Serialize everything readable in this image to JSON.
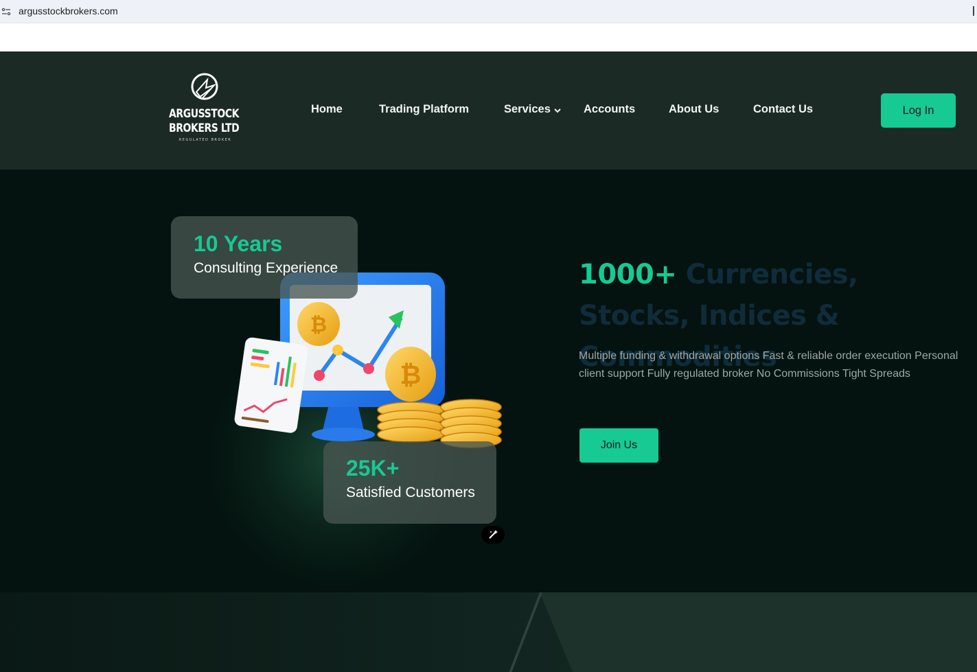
{
  "browser": {
    "url": "argusstockbrokers.com"
  },
  "logo": {
    "line1": "ARGUSSTOCK",
    "line2": "BROKERS LTD",
    "tagline": "REGULATED BROKER"
  },
  "nav": {
    "items": [
      {
        "label": "Home"
      },
      {
        "label": "Trading Platform"
      },
      {
        "label": "Services",
        "has_dropdown": true
      },
      {
        "label": "Accounts"
      },
      {
        "label": "About Us"
      },
      {
        "label": "Contact Us"
      }
    ],
    "login_label": "Log In"
  },
  "hero": {
    "stats": [
      {
        "value": "10 Years",
        "label": "Consulting Experience"
      },
      {
        "value": "25K+",
        "label": "Satisfied Customers"
      }
    ],
    "headline_accent": "1000+",
    "headline_rest": " Currencies, Stocks, Indices & Commodities",
    "description": "Multiple funding & withdrawal options Fast & reliable order execution Personal client support Fully regulated broker No Commissions Tight Spreads",
    "cta_label": "Join Us"
  },
  "colors": {
    "accent": "#17c993",
    "header_bg": "#1b2a25",
    "hero_bg": "#04130f",
    "headline_dark": "#102c3b"
  },
  "icons": {
    "site_info": "site-settings-icon",
    "dropdown": "chevron-down-icon",
    "magic": "magic-wand-icon"
  }
}
